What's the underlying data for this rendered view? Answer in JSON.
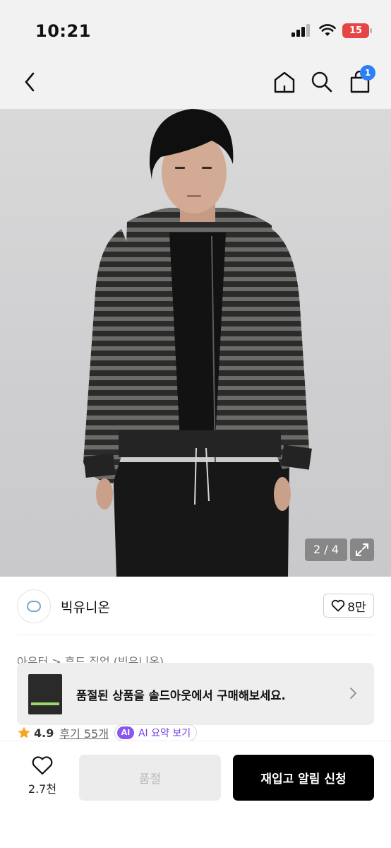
{
  "status_bar": {
    "time": "10:21",
    "battery": "15"
  },
  "nav": {
    "cart_count": "1"
  },
  "gallery": {
    "counter": "2 / 4"
  },
  "brand": {
    "name": "빅유니온",
    "likes": "8만"
  },
  "breadcrumb": "아우터 > 후드 집업 (빅유니온)",
  "soldout_banner": {
    "text": "품절된 상품을 솔드아웃에서 구매해보세요."
  },
  "rating": {
    "score": "4.9",
    "reviews": "후기 55개",
    "ai_badge": "AI",
    "ai_label": "AI 요약 보기"
  },
  "bottom_bar": {
    "wish_count": "2.7천",
    "soldout_label": "품절",
    "restock_label": "재입고 알림 신청"
  },
  "colors": {
    "accent_blue": "#2d7ff9",
    "ai_purple": "#8a55f0",
    "star": "#f5a623",
    "battery_low": "#e64545"
  }
}
